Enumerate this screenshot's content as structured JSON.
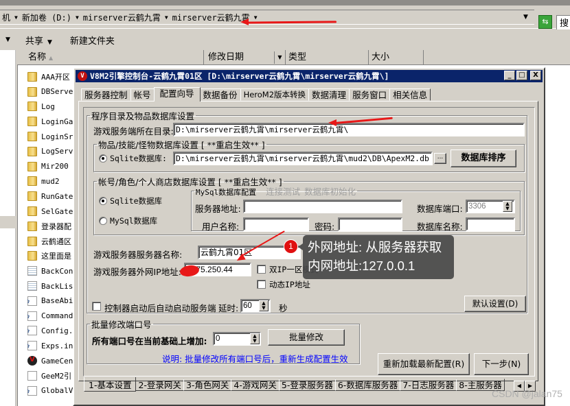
{
  "explorer": {
    "breadcrumb": [
      "机",
      "新加卷 (D:)",
      "mirserver云鹤九霄",
      "mirserver云鹤九霄"
    ],
    "search_placeholder": "搜",
    "toolbar": {
      "share": "共享",
      "new_folder": "新建文件夹"
    },
    "columns": {
      "name": "名称",
      "modified": "修改日期",
      "type": "类型",
      "size": "大小"
    },
    "files": [
      {
        "name": "AAA开区",
        "icon": "folder"
      },
      {
        "name": "DBServe",
        "icon": "folder"
      },
      {
        "name": "Log",
        "icon": "folder"
      },
      {
        "name": "LoginGa",
        "icon": "folder"
      },
      {
        "name": "LoginSr",
        "icon": "folder"
      },
      {
        "name": "LogServ",
        "icon": "folder"
      },
      {
        "name": "Mir200",
        "icon": "folder"
      },
      {
        "name": "mud2",
        "icon": "folder"
      },
      {
        "name": "RunGate",
        "icon": "folder"
      },
      {
        "name": "SelGate",
        "icon": "folder"
      },
      {
        "name": "登录器配",
        "icon": "folder"
      },
      {
        "name": "云鹤通区",
        "icon": "folder"
      },
      {
        "name": "这里面是",
        "icon": "folder"
      },
      {
        "name": "BackCon",
        "icon": "doc"
      },
      {
        "name": "BackLis",
        "icon": "doc"
      },
      {
        "name": "BaseAbi",
        "icon": "cfg"
      },
      {
        "name": "Command",
        "icon": "cfg"
      },
      {
        "name": "Config.",
        "icon": "cfg"
      },
      {
        "name": "Exps.in",
        "icon": "cfg"
      },
      {
        "name": "GameCen",
        "icon": "app"
      },
      {
        "name": "GeeM2引",
        "icon": "blank"
      },
      {
        "name": "GlobalV",
        "icon": "cfg"
      }
    ]
  },
  "dialog": {
    "title": "V8M2引擎控制台-云鹤九霄01区 [D:\\mirserver云鹤九霄\\mirserver云鹤九霄\\]",
    "window_buttons": {
      "minimize": "_",
      "maximize": "□",
      "close": "X"
    },
    "top_tabs": [
      "服务器控制",
      "帐号",
      "配置向导",
      "数据备份",
      "HeroM2版本转换",
      "数据清理",
      "服务窗口",
      "相关信息"
    ],
    "active_top_tab": "配置向导",
    "program_group": {
      "legend": "程序目录及物品数据库设置",
      "server_dir_label": "游戏服务端所在目录:",
      "server_dir_value": "D:\\mirserver云鹤九霄\\mirserver云鹤九霄\\",
      "item_db": {
        "legend": "物品/技能/怪物数据库设置 [ **重启生效** ]",
        "sqlite_label": "Sqlite数据库:",
        "sqlite_path": "D:\\mirserver云鹤九霄\\mirserver云鹤九霄\\mud2\\DB\\ApexM2.db",
        "browse_label": "...",
        "sort_button": "数据库排序"
      },
      "account_db": {
        "legend": "帐号/角色/个人商店数据库设置  [ **重启生效** ]",
        "sqlite_option": "Sqlite数据库",
        "mysql_option": "MySql数据库",
        "selected": "Sqlite数据库",
        "mysql_group": {
          "legend": "MySql数据库配置",
          "test_link": "连接测试",
          "init_link": "数据库初始化",
          "server_addr_label": "服务器地址:",
          "server_addr_value": "",
          "port_label": "数据库端口:",
          "port_value": "3306",
          "username_label": "用户名称:",
          "username_value": "",
          "password_label": "密码:",
          "password_value": "",
          "dbname_label": "数据库名称:",
          "dbname_value": ""
        }
      },
      "server_name_label": "游戏服务器服务器名称:",
      "server_name_value": "云鹤九霄01区",
      "ip_label": "游戏服务器外网IP地址:",
      "ip_value": "1 .75.250.44",
      "dual_ip_label": "双IP一区模式",
      "dual_ip_checked": false,
      "dynamic_ip_label": "动态IP地址",
      "dynamic_ip_checked": false,
      "autostart_label": "控制器启动后自动启动服务端",
      "autostart_checked": false,
      "delay_label": "延时:",
      "delay_value": "60",
      "delay_unit": "秒",
      "default_button": "默认设置(D)"
    },
    "batch_group": {
      "legend": "批量修改端口号",
      "increment_label": "所有端口号在当前基础上增加:",
      "increment_value": "0",
      "batch_button": "批量修改",
      "note": "说明: 批量修改所有端口号后，重新生成配置生效"
    },
    "reload_button": "重新加载最新配置(R)",
    "next_button": "下一步(N)",
    "bottom_tabs": [
      "1-基本设置",
      "2-登录网关",
      "3-角色网关",
      "4-游戏网关",
      "5-登录服务器",
      "6-数据库服务器",
      "7-日志服务器",
      "8-主服务器"
    ],
    "active_bottom_tab": "1-基本设置",
    "tab_scroll": {
      "left": "◀",
      "right": "▶"
    }
  },
  "annotation": {
    "badge": "1",
    "lines": [
      "外网地址: 从服务器获取",
      "内网地址:127.0.0.1"
    ],
    "arrow_color": "#e81818"
  },
  "watermark": "CSDN @jalan75",
  "colors": {
    "titlebar": "#0a246a",
    "note_text": "#0000ff",
    "dialog_bg": "#d4d0c8"
  }
}
